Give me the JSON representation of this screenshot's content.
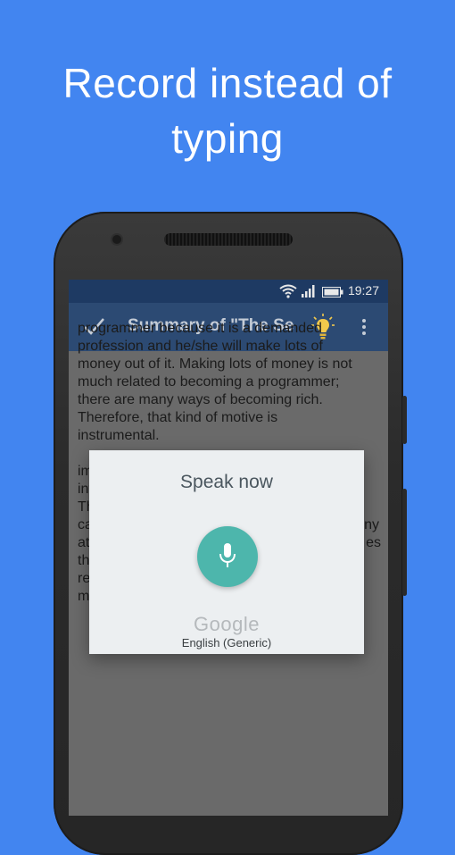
{
  "headline": {
    "line1": "Record instead of",
    "line2": "typing"
  },
  "status_bar": {
    "time": "19:27"
  },
  "toolbar": {
    "title": "Summary of \"The Sec"
  },
  "body_text": {
    "p1_lines": [
      "programmer because it is a demanded",
      "profession and he/she will make lots of",
      "money out of it. Making lots of money is not",
      "much related to becoming a programmer;",
      "there are many ways of becoming rich.",
      "Therefore, that kind of motive is",
      "instrumental."
    ],
    "p2_lines": [
      "im",
      "int",
      "Th",
      "ca",
      "at",
      "th",
      "re",
      "m"
    ],
    "p2_right": [
      "",
      "",
      "",
      "ny",
      "es",
      "",
      "",
      ""
    ]
  },
  "dialog": {
    "prompt": "Speak now",
    "brand": "Google",
    "language": "English (Generic)"
  },
  "colors": {
    "background": "#4285f0",
    "status_bar": "#1e3a63",
    "toolbar": "#2c4a73",
    "mic_button": "#4db6ac",
    "bulb": "#f2c94c"
  },
  "icons": [
    "wifi-icon",
    "signal-icon",
    "battery-icon",
    "check-icon",
    "lightbulb-icon",
    "more-vert-icon",
    "microphone-icon"
  ]
}
